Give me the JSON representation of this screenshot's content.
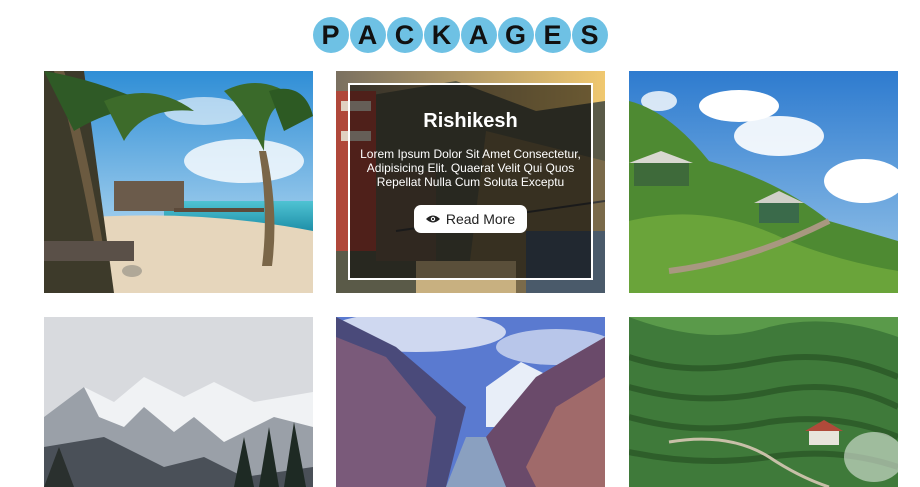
{
  "heading": {
    "letters": [
      "P",
      "A",
      "C",
      "K",
      "A",
      "G",
      "E",
      "S"
    ],
    "accent_color": "#6ec1e4"
  },
  "packages": [
    {
      "id": "beach"
    },
    {
      "id": "featured",
      "title": "Rishikesh",
      "description": "Lorem Ipsum Dolor Sit Amet Consectetur, Adipisicing Elit. Quaerat Velit Qui Quos Repellat Nulla Cum Soluta Exceptu",
      "button_label": "Read More",
      "button_icon": "eye-icon"
    },
    {
      "id": "hills"
    },
    {
      "id": "snow-mountains"
    },
    {
      "id": "valley"
    },
    {
      "id": "tea-gardens"
    }
  ]
}
